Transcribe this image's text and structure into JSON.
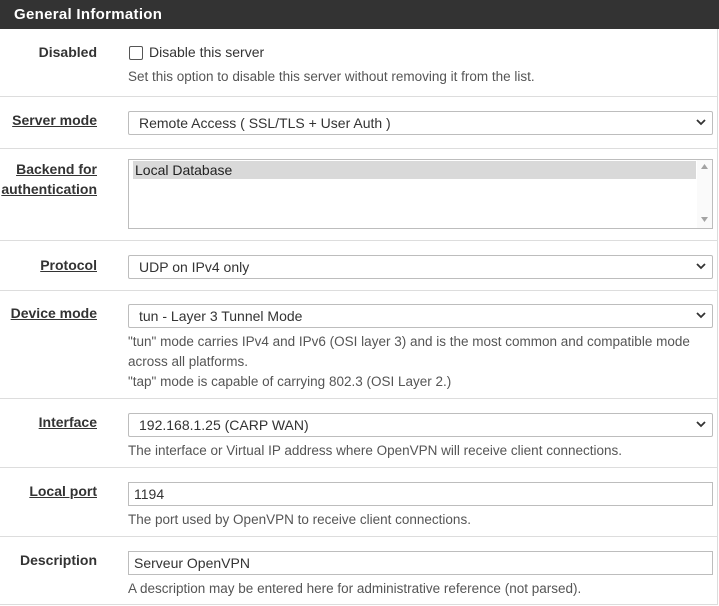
{
  "section": {
    "title": "General Information"
  },
  "disabled": {
    "label": "Disabled",
    "checkbox_label": "Disable this server",
    "checked": false,
    "hint": "Set this option to disable this server without removing it from the list."
  },
  "server_mode": {
    "label": "Server mode",
    "value": "Remote Access ( SSL/TLS + User Auth )"
  },
  "backend": {
    "label_line1": "Backend for",
    "label_line2": "authentication",
    "options": [
      "Local Database"
    ]
  },
  "protocol": {
    "label": "Protocol",
    "value": "UDP on IPv4 only"
  },
  "device_mode": {
    "label": "Device mode",
    "value": "tun - Layer 3 Tunnel Mode",
    "hint_line1": "\"tun\" mode carries IPv4 and IPv6 (OSI layer 3) and is the most common and compatible mode",
    "hint_line2": "across all platforms.",
    "hint_line3": "\"tap\" mode is capable of carrying 802.3 (OSI Layer 2.)"
  },
  "interface": {
    "label": "Interface",
    "value": "192.168.1.25 (CARP WAN)",
    "hint": "The interface or Virtual IP address where OpenVPN will receive client connections."
  },
  "local_port": {
    "label": "Local port",
    "value": "1194",
    "hint": "The port used by OpenVPN to receive client connections."
  },
  "description": {
    "label": "Description",
    "value": "Serveur OpenVPN",
    "hint": "A description may be entered here for administrative reference (not parsed)."
  },
  "icons": {
    "select_arrow": "chevron-down-icon",
    "scroll_up": "scroll-up-arrow-icon",
    "scroll_down": "scroll-down-arrow-icon"
  },
  "colors": {
    "heading_bg": "#333333",
    "heading_text": "#ffffff",
    "selected_option_bg": "#d9d9d9"
  }
}
